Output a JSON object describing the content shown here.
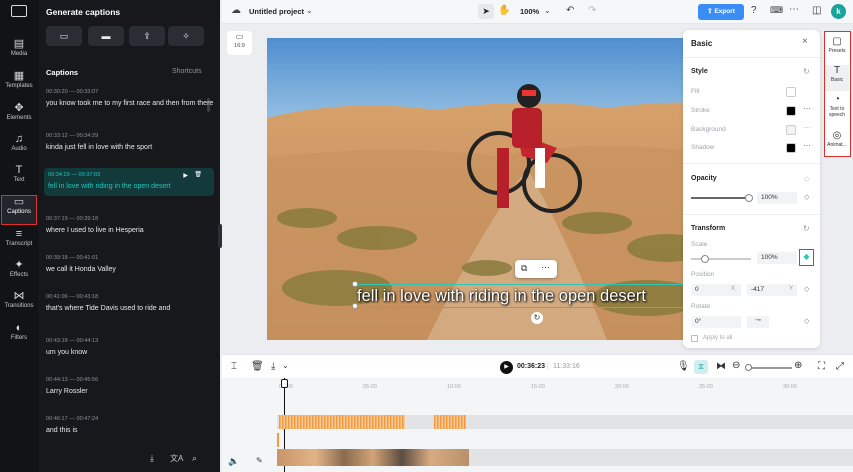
{
  "rail": {
    "logo_icon": "capcut-logo-icon",
    "items": [
      {
        "label": "Media",
        "icon": "▤"
      },
      {
        "label": "Templates",
        "icon": "▦"
      },
      {
        "label": "Elements",
        "icon": "✥"
      },
      {
        "label": "Audio",
        "icon": "♫"
      },
      {
        "label": "Text",
        "icon": "T"
      },
      {
        "label": "Captions",
        "icon": "▭"
      },
      {
        "label": "Transcript",
        "icon": "≡"
      },
      {
        "label": "Effects",
        "icon": "✦"
      },
      {
        "label": "Transitions",
        "icon": "⋈"
      },
      {
        "label": "Filters",
        "icon": "◐"
      }
    ],
    "active": "Captions"
  },
  "panel": {
    "title": "Generate captions",
    "section": "Captions",
    "shortcuts": "Shortcuts",
    "captions": [
      {
        "time": "00:30:20 — 00:33:07",
        "text": "you know took me to my first race and then from there"
      },
      {
        "time": "00:33:12 — 00:34:29",
        "text": "kinda just fell in love with the sport"
      },
      {
        "time": "00:34:29 — 00:37:03",
        "text": "fell in love with riding in the open desert"
      },
      {
        "time": "00:37:19 — 00:39:18",
        "text": "where I used to live in Hesperia"
      },
      {
        "time": "00:39:18 — 00:41:01",
        "text": "we call it Honda Valley"
      },
      {
        "time": "00:41:06 — 00:43:18",
        "text": "that's where Tide Davis used to ride and"
      },
      {
        "time": "00:43:18 — 00:44:13",
        "text": "um you know"
      },
      {
        "time": "00:44:13 — 00:45:56",
        "text": "Larry Rossler"
      },
      {
        "time": "00:46:17 — 00:47:24",
        "text": "and this is"
      }
    ]
  },
  "topbar": {
    "project": "Untitled project",
    "zoom": "100%",
    "export": "Export",
    "avatar": "k"
  },
  "canvas": {
    "ratio": "16:9",
    "subtitle": "fell in love with riding in the open desert"
  },
  "basic_panel": {
    "title": "Basic",
    "style_title": "Style",
    "fill": "Fill",
    "stroke": "Stroke",
    "background": "Background",
    "shadow": "Shadow",
    "opacity_title": "Opacity",
    "opacity_value": "100%",
    "transform_title": "Transform",
    "scale_label": "Scale",
    "scale_value": "100%",
    "position_label": "Position",
    "pos_x": "0",
    "x_label": "X",
    "pos_y": "-417",
    "y_label": "Y",
    "rotate_label": "Rotate",
    "rotate_value": "0°",
    "apply_all": "Apply to all"
  },
  "right_tools": [
    {
      "label": "Presets",
      "icon": "▢"
    },
    {
      "label": "Basic",
      "icon": "T"
    },
    {
      "label": "Text to speech",
      "icon": "◔"
    },
    {
      "label": "Animat...",
      "icon": "◎"
    }
  ],
  "controls": {
    "current": "00:36:23",
    "total": "11:33:16"
  },
  "timeline": {
    "ticks": [
      "00:00",
      "05:00",
      "10:00",
      "15:00",
      "20:00",
      "25:00",
      "30:00"
    ]
  }
}
